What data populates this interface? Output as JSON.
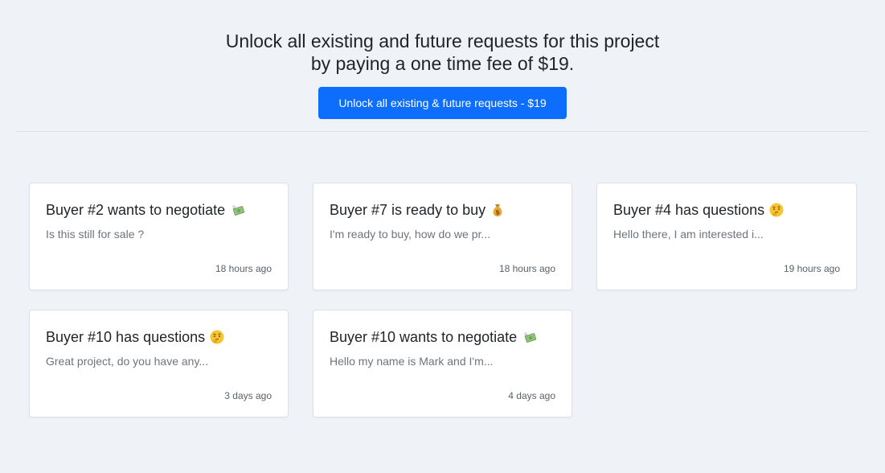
{
  "header": {
    "line1": "Unlock all existing and future requests for this project",
    "line2": "by paying a one time fee of $19.",
    "button_label": "Unlock all existing & future requests - $19"
  },
  "colors": {
    "primary": "#0d6efd",
    "background": "#eff2f7"
  },
  "requests": [
    {
      "title": "Buyer #2 wants to negotiate",
      "icon": "money-wings-icon",
      "preview": "Is this still for sale ?",
      "time": "18 hours ago"
    },
    {
      "title": "Buyer #7 is ready to buy",
      "icon": "money-bag-icon",
      "preview": "I'm ready to buy, how do we pr...",
      "time": "18 hours ago"
    },
    {
      "title": "Buyer #4 has questions",
      "icon": "thinking-face-icon",
      "preview": "Hello there, I am interested i...",
      "time": "19 hours ago"
    },
    {
      "title": "Buyer #10 has questions",
      "icon": "thinking-face-icon",
      "preview": "Great project, do you have any...",
      "time": "3 days ago"
    },
    {
      "title": "Buyer #10 wants to negotiate",
      "icon": "money-wings-icon",
      "preview": "Hello my name is Mark and I'm...",
      "time": "4 days ago"
    }
  ]
}
